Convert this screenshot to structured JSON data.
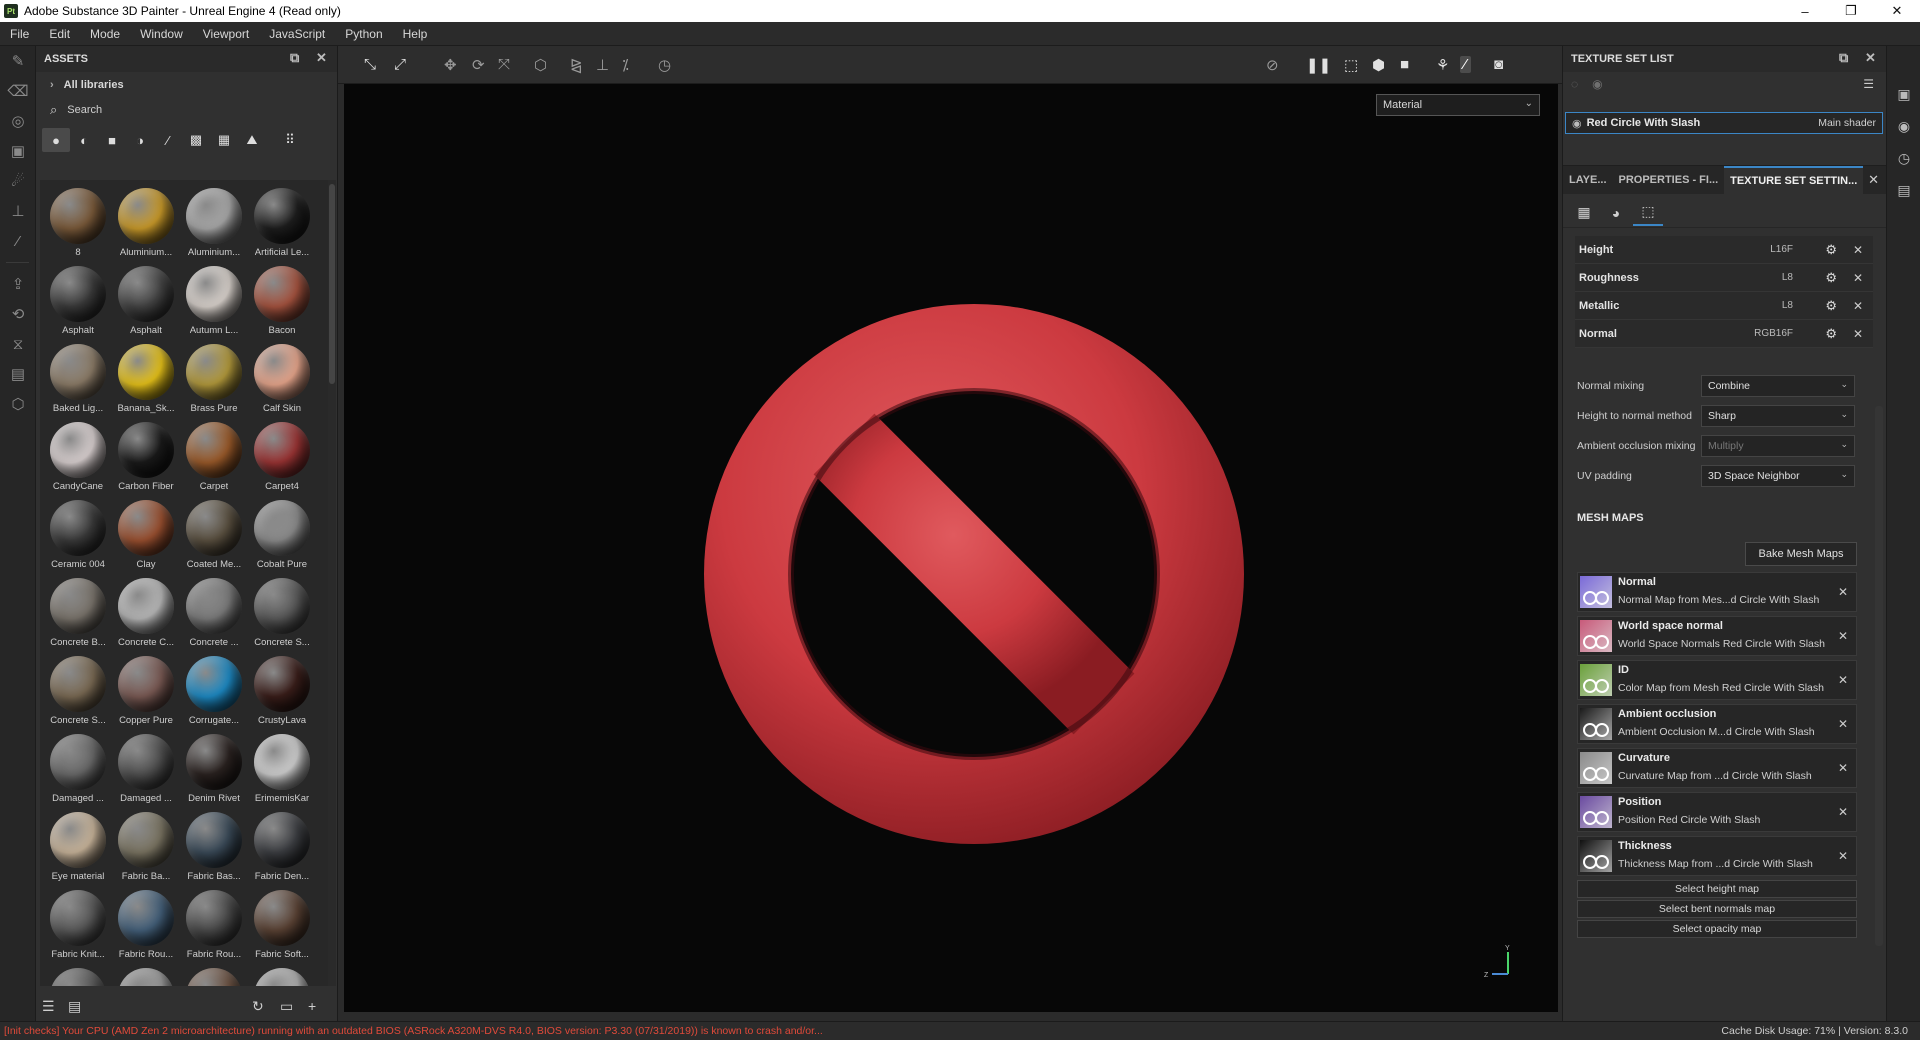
{
  "window": {
    "title": "Adobe Substance 3D Painter - Unreal Engine 4 (Read only)",
    "app_icon": "Pt",
    "controls": [
      "–",
      "❐",
      "✕"
    ]
  },
  "menu": [
    "File",
    "Edit",
    "Mode",
    "Window",
    "Viewport",
    "JavaScript",
    "Python",
    "Help"
  ],
  "assets": {
    "title": "ASSETS",
    "library": "All libraries",
    "search_placeholder": "Search",
    "items": [
      {
        "label": "8",
        "color": "#7a5a3a"
      },
      {
        "label": "Aluminium...",
        "color": "#c99a2a"
      },
      {
        "label": "Aluminium...",
        "color": "#a8a8a8"
      },
      {
        "label": "Artificial Le...",
        "color": "#1e1e1e"
      },
      {
        "label": "Asphalt",
        "color": "#3a3a3a"
      },
      {
        "label": "Asphalt",
        "color": "#444444"
      },
      {
        "label": "Autumn L...",
        "color": "#d9d2cc"
      },
      {
        "label": "Bacon",
        "color": "#a5533f"
      },
      {
        "label": "Baked Lig...",
        "color": "#8c7c68"
      },
      {
        "label": "Banana_Sk...",
        "color": "#e6c21a"
      },
      {
        "label": "Brass Pure",
        "color": "#b39a3c"
      },
      {
        "label": "Calf Skin",
        "color": "#e7a68c"
      },
      {
        "label": "CandyCane",
        "color": "#d9d0d0"
      },
      {
        "label": "Carbon Fiber",
        "color": "#1a1a1a"
      },
      {
        "label": "Carpet",
        "color": "#9a5a2a"
      },
      {
        "label": "Carpet4",
        "color": "#9a3434"
      },
      {
        "label": "Ceramic 004",
        "color": "#3a3a3a"
      },
      {
        "label": "Clay",
        "color": "#9a5030"
      },
      {
        "label": "Coated Me...",
        "color": "#5a5040"
      },
      {
        "label": "Cobalt Pure",
        "color": "#8c8c8c"
      },
      {
        "label": "Concrete B...",
        "color": "#7a746c"
      },
      {
        "label": "Concrete C...",
        "color": "#b8b8b8"
      },
      {
        "label": "Concrete ...",
        "color": "#7c7c7c"
      },
      {
        "label": "Concrete S...",
        "color": "#5a5a5a"
      },
      {
        "label": "Concrete S...",
        "color": "#7a6a54"
      },
      {
        "label": "Copper Pure",
        "color": "#7a5a54"
      },
      {
        "label": "Corrugate...",
        "color": "#1e8ac4"
      },
      {
        "label": "CrustyLava",
        "color": "#3a1e1a"
      },
      {
        "label": "Damaged ...",
        "color": "#6a6a6a"
      },
      {
        "label": "Damaged ...",
        "color": "#505050"
      },
      {
        "label": "Denim Rivet",
        "color": "#2a2220"
      },
      {
        "label": "ErimemisKar",
        "color": "#d0d0d0"
      },
      {
        "label": "Eye material",
        "color": "#c8b49a"
      },
      {
        "label": "Fabric Ba...",
        "color": "#7a7462"
      },
      {
        "label": "Fabric Bas...",
        "color": "#3a4a58"
      },
      {
        "label": "Fabric Den...",
        "color": "#3c3e42"
      },
      {
        "label": "Fabric Knit...",
        "color": "#5a5a5a"
      },
      {
        "label": "Fabric Rou...",
        "color": "#44607a"
      },
      {
        "label": "Fabric Rou...",
        "color": "#4a4a4a"
      },
      {
        "label": "Fabric Soft...",
        "color": "#5a4234"
      },
      {
        "label": "",
        "color": "#5a5a5a"
      },
      {
        "label": "",
        "color": "#9a9a9a"
      },
      {
        "label": "",
        "color": "#6a5040"
      },
      {
        "label": "",
        "color": "#b0b0b0"
      }
    ]
  },
  "viewport": {
    "mode_select": "Material",
    "axis_y": "Y",
    "axis_z": "Z"
  },
  "texture_set_list": {
    "title": "TEXTURE SET LIST",
    "set_name": "Red Circle With Slash",
    "shader": "Main shader"
  },
  "tabs": {
    "layers": "LAYE...",
    "properties": "PROPERTIES - FI...",
    "texture_settings": "TEXTURE SET SETTIN..."
  },
  "channels": [
    {
      "name": "Height",
      "format": "L16F"
    },
    {
      "name": "Roughness",
      "format": "L8"
    },
    {
      "name": "Metallic",
      "format": "L8"
    },
    {
      "name": "Normal",
      "format": "RGB16F"
    }
  ],
  "settings": {
    "normal_mixing_label": "Normal mixing",
    "normal_mixing_value": "Combine",
    "height_to_normal_label": "Height to normal method",
    "height_to_normal_value": "Sharp",
    "ao_mixing_label": "Ambient occlusion mixing",
    "ao_mixing_value": "Multiply",
    "uv_padding_label": "UV padding",
    "uv_padding_value": "3D Space Neighbor"
  },
  "mesh_maps": {
    "section_title": "MESH MAPS",
    "bake_button": "Bake Mesh Maps",
    "items": [
      {
        "title": "Normal",
        "subtitle": "Normal Map from Mes...d Circle With Slash",
        "color": "#7a6ad8"
      },
      {
        "title": "World space normal",
        "subtitle": "World Space Normals Red Circle With Slash",
        "color": "#c85a7a"
      },
      {
        "title": "ID",
        "subtitle": "Color Map from Mesh Red Circle With Slash",
        "color": "#6aa03a"
      },
      {
        "title": "Ambient occlusion",
        "subtitle": "Ambient Occlusion M...d Circle With Slash",
        "color": "#1a1a1a"
      },
      {
        "title": "Curvature",
        "subtitle": "Curvature Map from ...d Circle With Slash",
        "color": "#8a8a8a"
      },
      {
        "title": "Position",
        "subtitle": "Position Red Circle With Slash",
        "color": "#6a4aa0"
      },
      {
        "title": "Thickness",
        "subtitle": "Thickness Map from ...d Circle With Slash",
        "color": "#101010"
      }
    ],
    "select_height": "Select height map",
    "select_bent": "Select bent normals map",
    "select_opacity": "Select opacity map"
  },
  "status": {
    "warning": "[Init checks] Your CPU (AMD Zen 2 microarchitecture) running with an outdated BIOS (ASRock A320M-DVS R4.0, BIOS version: P3.30 (07/31/2019)) is known to crash and/or...",
    "right": "Cache Disk Usage:   71% | Version: 8.3.0"
  }
}
